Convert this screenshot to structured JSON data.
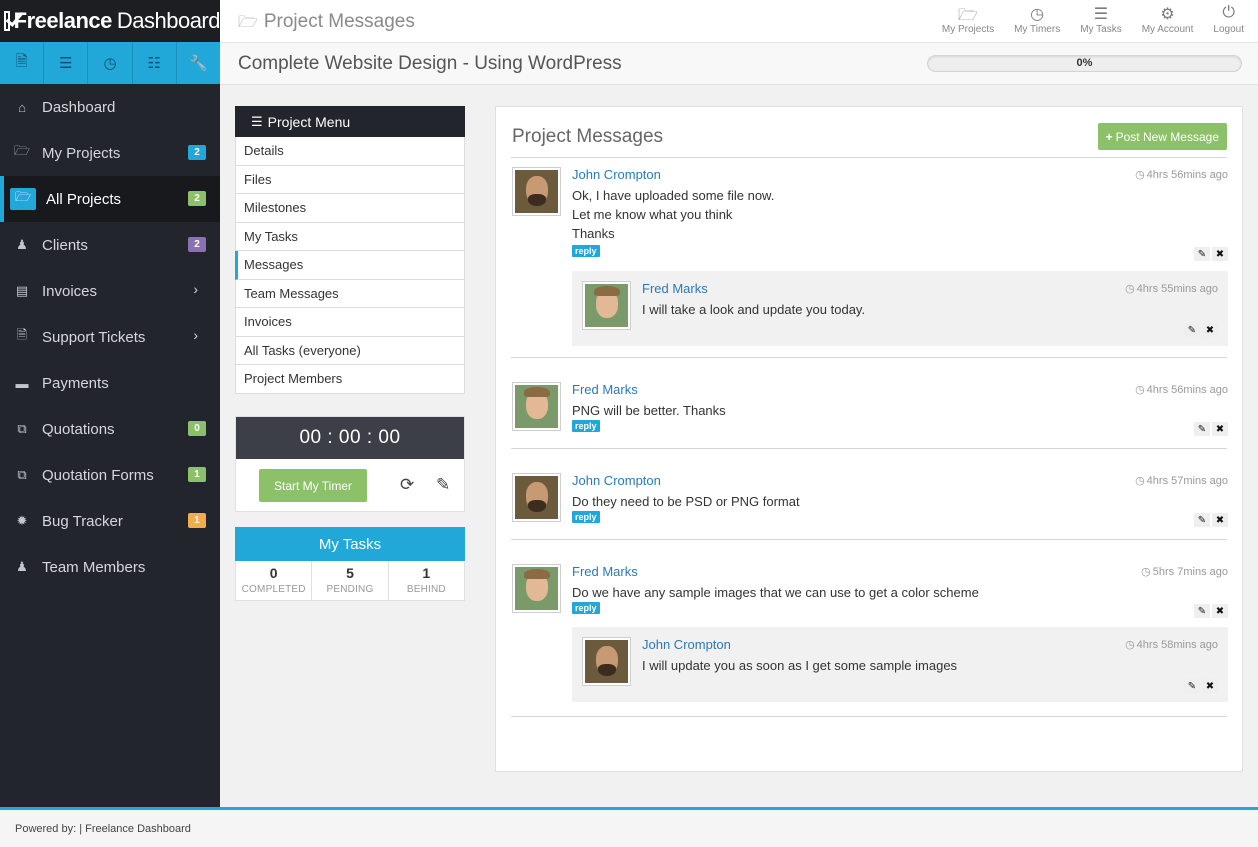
{
  "app": {
    "title_bold": "Freelance",
    "title_rest": "Dashboard"
  },
  "icon_tabs": [
    "file-icon",
    "list-icon",
    "clock-icon",
    "sitemap-icon",
    "wrench-icon"
  ],
  "sidebar": {
    "items": [
      {
        "label": "Dashboard",
        "icon": "home-icon"
      },
      {
        "label": "My Projects",
        "icon": "folder-open-icon",
        "badge": "2",
        "badge_color": "#22a7d9"
      },
      {
        "label": "All Projects",
        "icon": "folder-open-icon",
        "badge": "2",
        "badge_color": "#8cc16a",
        "active": true
      },
      {
        "label": "Clients",
        "icon": "user-icon",
        "badge": "2",
        "badge_color": "#8a72b2"
      },
      {
        "label": "Invoices",
        "icon": "invoice-icon",
        "chevron": true
      },
      {
        "label": "Support Tickets",
        "icon": "document-icon",
        "chevron": true
      },
      {
        "label": "Payments",
        "icon": "credit-card-icon"
      },
      {
        "label": "Quotations",
        "icon": "copy-icon",
        "badge": "0",
        "badge_color": "#8cc16a"
      },
      {
        "label": "Quotation Forms",
        "icon": "copy-icon",
        "badge": "1",
        "badge_color": "#8cc16a"
      },
      {
        "label": "Bug Tracker",
        "icon": "bug-icon",
        "badge": "1",
        "badge_color": "#f0ad4e"
      },
      {
        "label": "Team Members",
        "icon": "users-icon"
      }
    ]
  },
  "header": {
    "page_title": "Project Messages",
    "nav": [
      {
        "label": "My Projects",
        "icon": "folder-open-icon"
      },
      {
        "label": "My Timers",
        "icon": "clock-icon"
      },
      {
        "label": "My Tasks",
        "icon": "list-icon"
      },
      {
        "label": "My Account",
        "icon": "cogs-icon"
      },
      {
        "label": "Logout",
        "icon": "power-icon"
      }
    ]
  },
  "project": {
    "title": "Complete Website Design - Using WordPress",
    "progress": 0,
    "progress_label": "0%"
  },
  "project_menu": {
    "title": "Project Menu",
    "items": [
      "Details",
      "Files",
      "Milestones",
      "My Tasks",
      "Messages",
      "Team Messages",
      "Invoices",
      "All Tasks (everyone)",
      "Project Members"
    ],
    "active_index": 4
  },
  "timer": {
    "display": "00 : 00 : 00",
    "start_label": "Start My Timer"
  },
  "my_tasks": {
    "title": "My Tasks",
    "stats": [
      {
        "value": "0",
        "label": "COMPLETED"
      },
      {
        "value": "5",
        "label": "PENDING"
      },
      {
        "value": "1",
        "label": "BEHIND"
      }
    ]
  },
  "messages_panel": {
    "title": "Project Messages",
    "post_label": "Post New Message",
    "reply_label": "reply",
    "messages": [
      {
        "author": "John Crompton",
        "avatar": "john",
        "time": "4hrs 56mins ago",
        "lines": [
          "Ok, I have uploaded some file now.",
          "Let me know what you think",
          "Thanks"
        ],
        "replies": [
          {
            "author": "Fred Marks",
            "avatar": "fred",
            "time": "4hrs 55mins ago",
            "text": "I will take a look and update you today."
          }
        ]
      },
      {
        "author": "Fred Marks",
        "avatar": "fred",
        "time": "4hrs 56mins ago",
        "lines": [
          "PNG will be better. Thanks"
        ]
      },
      {
        "author": "John Crompton",
        "avatar": "john",
        "time": "4hrs 57mins ago",
        "lines": [
          "Do they need to be PSD or PNG format"
        ]
      },
      {
        "author": "Fred Marks",
        "avatar": "fred",
        "time": "5hrs 7mins ago",
        "lines": [
          "Do we have any sample images that we can use to get a color scheme"
        ],
        "replies": [
          {
            "author": "John Crompton",
            "avatar": "john",
            "time": "4hrs 58mins ago",
            "text": "I will update you as soon as I get some sample images"
          }
        ]
      }
    ]
  },
  "footer": {
    "text": "Powered by: | Freelance Dashboard"
  }
}
